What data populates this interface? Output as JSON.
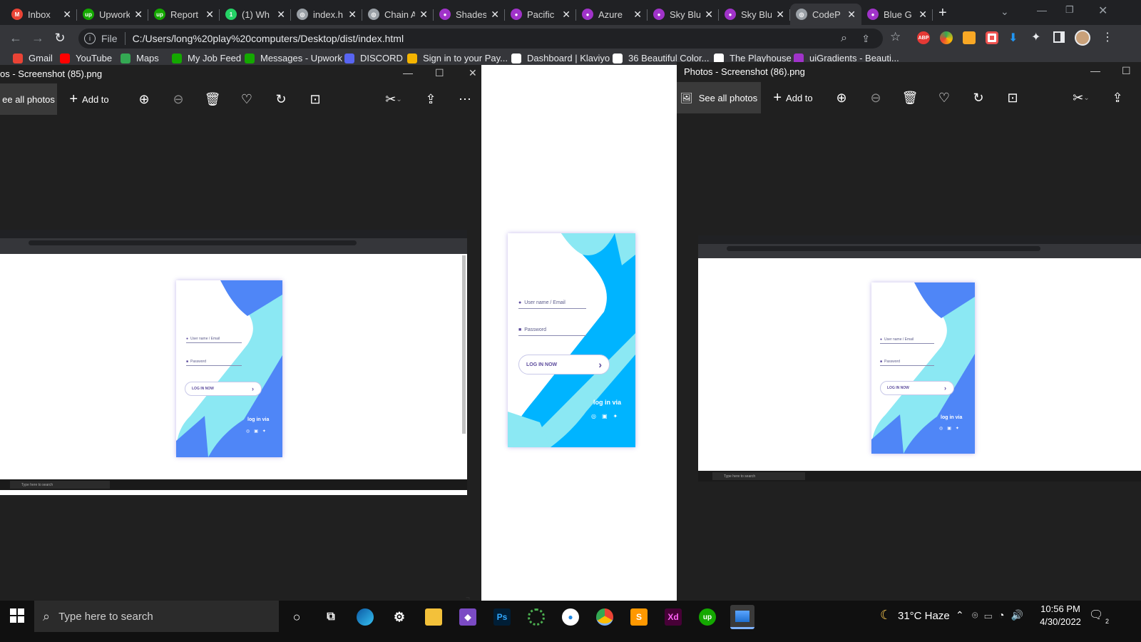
{
  "browser": {
    "tabs": [
      {
        "label": "Inbox",
        "icon": "gmail-icon",
        "color": "#ea4335",
        "glyph": "M"
      },
      {
        "label": "Upwork",
        "icon": "upwork-icon",
        "color": "#14a800",
        "glyph": "up"
      },
      {
        "label": "Report",
        "icon": "upwork-icon",
        "color": "#14a800",
        "glyph": "up"
      },
      {
        "label": "(1) Wh",
        "icon": "whatsapp-icon",
        "color": "#25d366",
        "glyph": "1"
      },
      {
        "label": "index.h",
        "icon": "globe-icon",
        "color": "#9aa0a6",
        "glyph": "◎"
      },
      {
        "label": "Chain A",
        "icon": "globe-icon",
        "color": "#9aa0a6",
        "glyph": "◎"
      },
      {
        "label": "Shades",
        "icon": "drop-icon",
        "color": "#a033c9",
        "glyph": "●"
      },
      {
        "label": "Pacific",
        "icon": "drop-icon",
        "color": "#a033c9",
        "glyph": "●"
      },
      {
        "label": "Azure",
        "icon": "drop-icon",
        "color": "#a033c9",
        "glyph": "●"
      },
      {
        "label": "Sky Blu",
        "icon": "drop-icon",
        "color": "#a033c9",
        "glyph": "●"
      },
      {
        "label": "Sky Blu",
        "icon": "drop-icon",
        "color": "#a033c9",
        "glyph": "●"
      },
      {
        "label": "CodeP",
        "icon": "globe-icon",
        "color": "#9aa0a6",
        "glyph": "◎",
        "active": true
      },
      {
        "label": "Blue G",
        "icon": "drop-icon",
        "color": "#a033c9",
        "glyph": "●"
      }
    ],
    "new_tab": "+",
    "address": {
      "scheme": "File",
      "url": "C:/Users/long%20play%20computers/Desktop/dist/index.html"
    },
    "bookmarks": [
      {
        "label": "Gmail",
        "color": "#ea4335"
      },
      {
        "label": "YouTube",
        "color": "#ff0000"
      },
      {
        "label": "Maps",
        "color": "#34a853"
      },
      {
        "label": "My Job Feed",
        "color": "#14a800"
      },
      {
        "label": "Messages - Upwork",
        "color": "#14a800"
      },
      {
        "label": "DISCORD",
        "color": "#5865f2"
      },
      {
        "label": "Sign in to your Pay...",
        "color": "#f4b400"
      },
      {
        "label": "Dashboard | Klaviyo",
        "color": "#ffffff"
      },
      {
        "label": "36 Beautiful Color...",
        "color": "#ffffff"
      },
      {
        "label": "The Playhouse",
        "color": "#ffffff"
      },
      {
        "label": "uiGradients - Beauti...",
        "color": "#a033c9"
      }
    ]
  },
  "photos_left": {
    "title": "os - Screenshot (85).png",
    "see_all": "ee all photos",
    "add_to": "Add to"
  },
  "photos_right": {
    "title": "Photos - Screenshot (86).png",
    "see_all": "See all photos",
    "add_to": "Add to"
  },
  "login_card": {
    "username_placeholder": "User name / Email",
    "password_placeholder": "Password",
    "login_button": "LOG IN NOW",
    "login_via": "log in via",
    "colors": {
      "cyan": "#8be8f3",
      "blue": "#00b4ff",
      "royal": "#4f86f7"
    }
  },
  "mini_taskbar_search": "Type here to search",
  "taskbar": {
    "search_placeholder": "Type here to search",
    "weather": "31°C  Haze",
    "time": "10:56 PM",
    "date": "4/30/2022",
    "notifications": "2"
  }
}
